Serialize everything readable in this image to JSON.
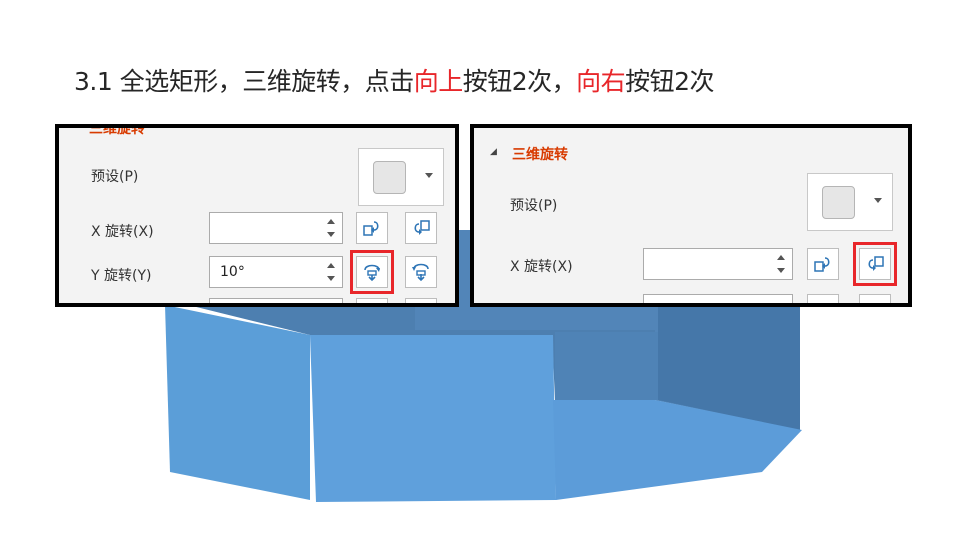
{
  "slide": {
    "title_part1": "3.1 全选矩形，三维旋转，点击",
    "title_hl1": "向上",
    "title_part2": "按钮2次，",
    "title_hl2": "向右",
    "title_part3": "按钮2次"
  },
  "left_panel": {
    "section_label": "三维旋转",
    "preset_label": "预设(P)",
    "x_label": "X 旋转(X)",
    "x_value": "",
    "y_label": "Y 旋转(Y)",
    "y_value": "10°",
    "x_buttons": [
      "rotate-left-icon",
      "rotate-right-icon"
    ],
    "y_buttons": [
      "rotate-up-icon",
      "rotate-down-icon"
    ],
    "highlighted_button": "y-rotate-up-button"
  },
  "right_panel": {
    "section_label": "三维旋转",
    "preset_label": "预设(P)",
    "x_label": "X 旋转(X)",
    "x_value": "",
    "x_buttons": [
      "rotate-left-icon",
      "rotate-right-icon"
    ],
    "highlighted_button": "x-rotate-right-button"
  },
  "colors": {
    "highlight": "#e8262a",
    "accent_icon": "#2e75b6",
    "section_head": "#d83b01",
    "shape_front": "#5b9bd5",
    "shape_dark": "#4a7fb0"
  }
}
